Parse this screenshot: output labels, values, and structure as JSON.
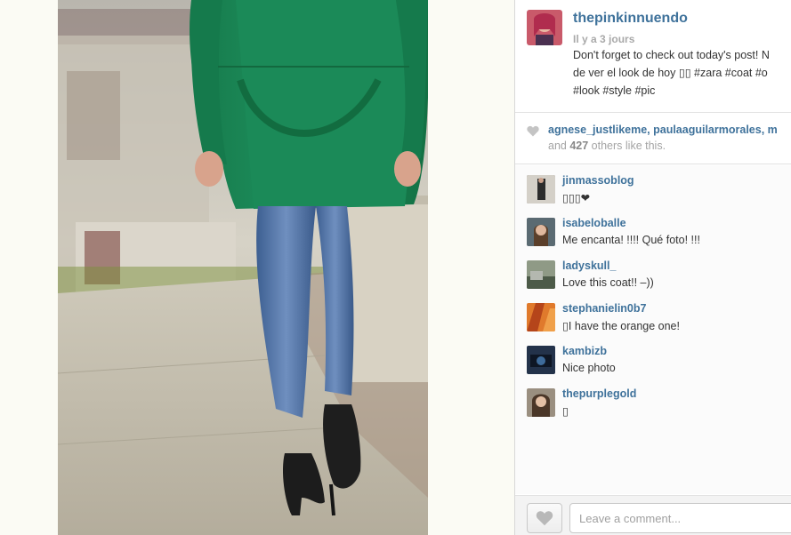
{
  "post": {
    "username": "thepinkinnuendo",
    "timestamp": "Il y a 3 jours",
    "caption_lines": [
      "Don't forget to check out today's post! N",
      "de ver el look de hoy ▯▯ #zara #coat #o",
      "#look #style #pic"
    ]
  },
  "likes": {
    "names": "agnese_justlikeme, paulaaguilarmorales, m",
    "others_prefix": "and ",
    "others_count": "427",
    "others_suffix": " others like this."
  },
  "comments": [
    {
      "user": "jinmassoblog",
      "text": "▯▯▯❤",
      "avatar_color": "#6b6b6b"
    },
    {
      "user": "isabeloballe",
      "text": "Me encanta! !!!! Qué foto! !!!",
      "avatar_color": "#7a6a4a"
    },
    {
      "user": "ladyskull_",
      "text": "Love this coat!! –))",
      "avatar_color": "#5a6a52"
    },
    {
      "user": "stephanielin0b7",
      "text": "▯I have the orange one!",
      "avatar_color": "#c2571f"
    },
    {
      "user": "kambizb",
      "text": "Nice photo",
      "avatar_color": "#2b3a4a"
    },
    {
      "user": "thepurplegold",
      "text": "▯",
      "avatar_color": "#8a7a6a"
    }
  ],
  "composer": {
    "placeholder": "Leave a comment..."
  },
  "icons": {
    "like": "heart-icon",
    "like_small": "heart-icon"
  },
  "colors": {
    "link": "#3f729b",
    "muted": "#a9a9a9",
    "coat": "#1f8a57"
  }
}
